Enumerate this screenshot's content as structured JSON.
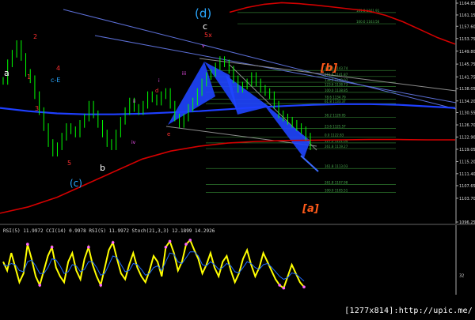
{
  "chart_data": [
    {
      "type": "line",
      "title": "",
      "price_axis": {
        "ticks": [
          "1164.85",
          "1161.15",
          "1157.60",
          "1153.75",
          "1149.80",
          "1145.75",
          "1141.75",
          "1138.05",
          "1134.20",
          "1130.55",
          "1126.70",
          "1122.90",
          "1119.05",
          "1115.20",
          "1111.40",
          "1107.65",
          "1103.70",
          "1096.25"
        ],
        "ylim": [
          1096.25,
          1164.85
        ]
      },
      "price_series": {
        "name": "",
        "color": "#00ff00",
        "values": [
          1140.5,
          1146,
          1149,
          1152,
          1148,
          1143,
          1141,
          1136,
          1131,
          1126,
          1121,
          1118,
          1120,
          1123,
          1126,
          1125,
          1124,
          1127,
          1129,
          1133,
          1130,
          1127,
          1124,
          1121,
          1120,
          1124,
          1128,
          1131,
          1134,
          1132,
          1131,
          1133,
          1136,
          1135,
          1134,
          1136,
          1137,
          1133,
          1129,
          1127,
          1129,
          1132,
          1134,
          1137,
          1140,
          1142,
          1143,
          1145,
          1147,
          1146,
          1144,
          1141,
          1138,
          1139,
          1140,
          1142,
          1140,
          1138,
          1137,
          1136,
          1133,
          1130,
          1129,
          1128,
          1127,
          1126,
          1125,
          1123,
          1120
        ]
      },
      "moving_averages": [
        {
          "name": "",
          "color": "#1e3fff",
          "values": [
            1132,
            1131,
            1130.3,
            1130,
            1130,
            1130.2,
            1130.6,
            1131,
            1131.6,
            1132.2,
            1132.6,
            1133,
            1133.2,
            1133.2,
            1133,
            1132.5,
            1132
          ]
        },
        {
          "name": "",
          "color": "#d40000",
          "values": [
            1099,
            1101,
            1104,
            1108,
            1112,
            1116,
            1118.5,
            1120,
            1121,
            1121.5,
            1121.8,
            1121.9,
            1122,
            1122.1,
            1122.1,
            1122,
            1122
          ]
        },
        {
          "name": "",
          "color": "#d40000",
          "values": [
            1162,
            1163.5,
            1164.5,
            1165,
            1164.7,
            1164.2,
            1163.6,
            1163,
            1162.4,
            1161,
            1159,
            1156.5,
            1154,
            1152
          ]
        }
      ],
      "fibonacci_levels": [
        {
          "label": "161.8 1161.91",
          "price": 1161.91
        },
        {
          "label": "100.0 1163.56",
          "price": 1158.4
        },
        {
          "label": "200.0 1143.74",
          "price": 1143.74
        },
        {
          "label": "161.8 1141.87",
          "price": 1141.87
        },
        {
          "label": "138.2 1140.07",
          "price": 1140.07
        },
        {
          "label": "123.6 1138.73",
          "price": 1138.73
        },
        {
          "label": "100.0 1138.85",
          "price": 1136.9
        },
        {
          "label": "78.6 1134.79",
          "price": 1134.79
        },
        {
          "label": "61.8 1133.37",
          "price": 1133.37
        },
        {
          "label": "38.2 1129.05",
          "price": 1129.05
        },
        {
          "label": "23.6 1125.57",
          "price": 1125.57
        },
        {
          "label": "0.0 1122.83",
          "price": 1122.83
        },
        {
          "label": "127.2 1121.04",
          "price": 1121.04
        },
        {
          "label": "261.8 1119.27",
          "price": 1119.27
        },
        {
          "label": "161.8 1113.03",
          "price": 1113.03
        },
        {
          "label": "261.8 1107.98",
          "price": 1107.98
        },
        {
          "label": "100.0 1105.51",
          "price": 1105.51
        }
      ],
      "wave_labels": [
        {
          "text": "(d)",
          "color": "#2aa8ff"
        },
        {
          "text": "c",
          "color": "#ffffff"
        },
        {
          "text": "5x",
          "color": "#ff3030"
        },
        {
          "text": "[b]",
          "color": "#ff5a1a"
        },
        {
          "text": "[a]",
          "color": "#ff5a1a"
        },
        {
          "text": "(c)",
          "color": "#2aa8ff"
        },
        {
          "text": "a",
          "color": "#ffffff"
        },
        {
          "text": "b",
          "color": "#ffffff"
        },
        {
          "text": "5",
          "color": "#ff3030"
        },
        {
          "text": "4",
          "color": "#ff3030"
        },
        {
          "text": "3",
          "color": "#ff3030"
        },
        {
          "text": "2",
          "color": "#ff3030"
        },
        {
          "text": "1",
          "color": "#ff3030"
        },
        {
          "text": "c-E",
          "color": "#2aa8ff"
        },
        {
          "text": "e",
          "color": "#ff3030"
        },
        {
          "text": "d",
          "color": "#ff3030"
        },
        {
          "text": "iii",
          "color": "#ff55ff"
        },
        {
          "text": "iv",
          "color": "#ff55ff"
        },
        {
          "text": "v",
          "color": "#ff55ff"
        },
        {
          "text": "ii",
          "color": "#ff55ff"
        },
        {
          "text": "i",
          "color": "#ff55ff"
        }
      ]
    },
    {
      "type": "line",
      "title": "RSI(5) 11.9972 CCI(14) 0.9978 RSI(5) 11.9972 Stoch(21,3,3) 12.1899 14.2926",
      "xlabel": "",
      "ylabel": "",
      "ylim": [
        0,
        100
      ],
      "axis_ticks": [
        "32"
      ],
      "series": [
        {
          "name": "",
          "color": "#ffff00",
          "values": [
            55,
            40,
            70,
            45,
            20,
            35,
            85,
            60,
            30,
            15,
            40,
            65,
            80,
            45,
            30,
            20,
            55,
            70,
            40,
            25,
            60,
            80,
            50,
            30,
            15,
            45,
            75,
            88,
            60,
            35,
            25,
            50,
            70,
            45,
            30,
            20,
            40,
            65,
            55,
            30,
            80,
            90,
            70,
            40,
            55,
            85,
            92,
            75,
            60,
            35,
            50,
            70,
            45,
            30,
            55,
            65,
            40,
            20,
            35,
            60,
            75,
            50,
            30,
            45,
            70,
            55,
            40,
            25,
            15,
            10,
            30,
            50,
            35,
            20,
            12
          ]
        },
        {
          "name": "",
          "color": "#1e6bff",
          "values": [
            50,
            48,
            52,
            50,
            40,
            38,
            55,
            58,
            48,
            35,
            35,
            45,
            60,
            58,
            48,
            35,
            38,
            50,
            48,
            38,
            42,
            55,
            55,
            45,
            32,
            35,
            50,
            65,
            62,
            50,
            38,
            40,
            52,
            50,
            42,
            32,
            35,
            45,
            48,
            40,
            55,
            70,
            68,
            55,
            52,
            62,
            72,
            72,
            65,
            50,
            48,
            55,
            50,
            42,
            45,
            52,
            48,
            38,
            36,
            45,
            55,
            52,
            45,
            42,
            50,
            52,
            46,
            38,
            30,
            25,
            28,
            36,
            34,
            28,
            22
          ]
        },
        {
          "name": "",
          "color": "#ff66ff",
          "values": []
        }
      ]
    }
  ],
  "watermark": "[1277x814]:http://upic.me/"
}
